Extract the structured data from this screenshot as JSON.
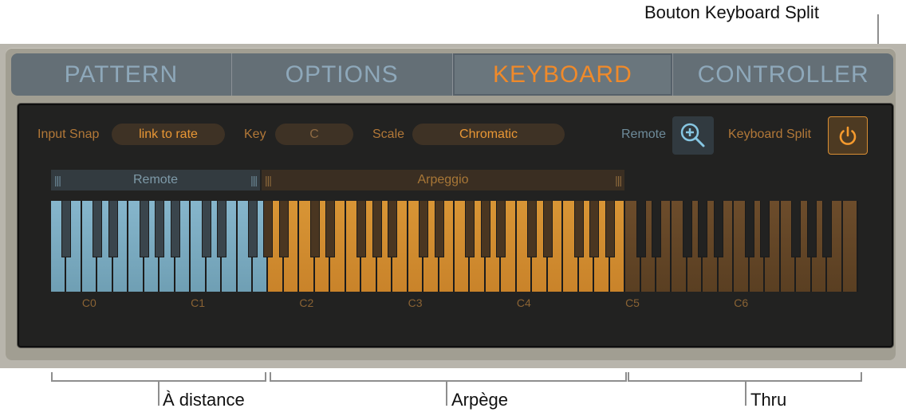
{
  "callouts": {
    "keyboard_split_button": "Bouton Keyboard Split",
    "remote_zone": "À distance",
    "arpeggio_zone": "Arpège",
    "thru_zone": "Thru"
  },
  "tabs": [
    {
      "label": "PATTERN",
      "active": false
    },
    {
      "label": "OPTIONS",
      "active": false
    },
    {
      "label": "KEYBOARD",
      "active": true
    },
    {
      "label": "CONTROLLER",
      "active": false
    }
  ],
  "controls": {
    "input_snap_label": "Input Snap",
    "input_snap_value": "link to rate",
    "key_label": "Key",
    "key_value": "C",
    "scale_label": "Scale",
    "scale_value": "Chromatic",
    "remote_label": "Remote",
    "remote_icon": "zoom-in-icon",
    "keyboard_split_label": "Keyboard Split",
    "keyboard_split_icon": "power-icon",
    "keyboard_split_on": true
  },
  "zones": {
    "remote_label": "Remote",
    "arpeggio_label": "Arpeggio",
    "grip": "|||"
  },
  "keyboard": {
    "lowest_note": "A-1",
    "highest_note": "C7",
    "white_key_count": 52,
    "remote_white_keys": 14,
    "arpeggio_white_keys": 23,
    "thru_white_keys": 15,
    "colors": {
      "remote_white": "#7fafc6",
      "remote_black": "#3a454c",
      "arp_white": "#d48d30",
      "arp_black": "#4a3621",
      "thru_white": "#66482a",
      "thru_black": "#222221"
    },
    "octave_labels": [
      "C0",
      "C1",
      "C2",
      "C3",
      "C4",
      "C5",
      "C6"
    ]
  }
}
